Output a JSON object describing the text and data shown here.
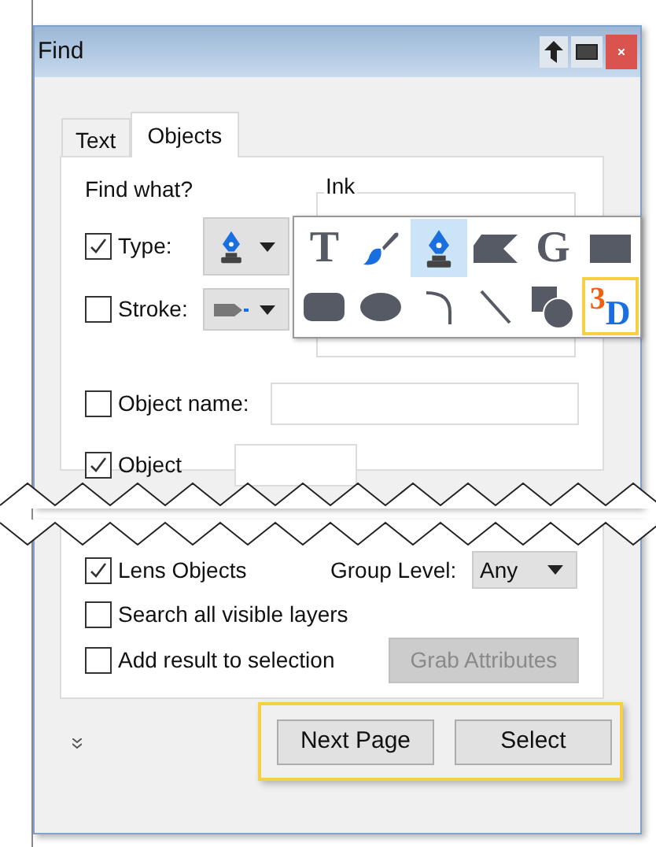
{
  "window": {
    "title": "Find"
  },
  "tabs": [
    {
      "label": "Text",
      "selected": false
    },
    {
      "label": "Objects",
      "selected": true
    }
  ],
  "find_what": {
    "label": "Find what?",
    "rows": [
      {
        "label": "Type:",
        "checked": true,
        "kind": "type"
      },
      {
        "label": "Stroke:",
        "checked": false,
        "kind": "stroke"
      }
    ]
  },
  "ink_group": {
    "label": "Ink"
  },
  "palette": [
    {
      "kind": "glyph",
      "glyph": "T",
      "selected": false,
      "highlighted": false
    },
    {
      "kind": "brush",
      "selected": false,
      "highlighted": false
    },
    {
      "kind": "pen",
      "selected": true,
      "highlighted": false
    },
    {
      "kind": "wedge",
      "selected": false,
      "highlighted": false
    },
    {
      "kind": "glyph",
      "glyph": "G",
      "selected": false,
      "highlighted": false
    },
    {
      "kind": "rect",
      "selected": false,
      "highlighted": false
    },
    {
      "kind": "rounded-rect",
      "selected": false,
      "highlighted": false
    },
    {
      "kind": "ellipse",
      "selected": false,
      "highlighted": false
    },
    {
      "kind": "curve",
      "selected": false,
      "highlighted": false
    },
    {
      "kind": "line",
      "selected": false,
      "highlighted": false
    },
    {
      "kind": "overlap",
      "selected": false,
      "highlighted": false
    },
    {
      "kind": "dimensional",
      "glyph": "3",
      "sub": "D",
      "selected": false,
      "highlighted": true
    }
  ],
  "object_name": {
    "label": "Object name:",
    "checked": false
  },
  "object_row": {
    "label": "Object",
    "checked": true
  },
  "lens_row": {
    "label": "Lens Objects",
    "checked": true
  },
  "group_level": {
    "label": "Group Level:",
    "value": "Any"
  },
  "options": [
    {
      "label": "Search all visible layers",
      "checked": false
    },
    {
      "label": "Add result to selection",
      "checked": false
    }
  ],
  "grab_button": {
    "label": "Grab Attributes",
    "disabled": true
  },
  "footer": {
    "highlighted": true,
    "buttons": [
      {
        "label": "Next Page"
      },
      {
        "label": "Select"
      }
    ]
  }
}
